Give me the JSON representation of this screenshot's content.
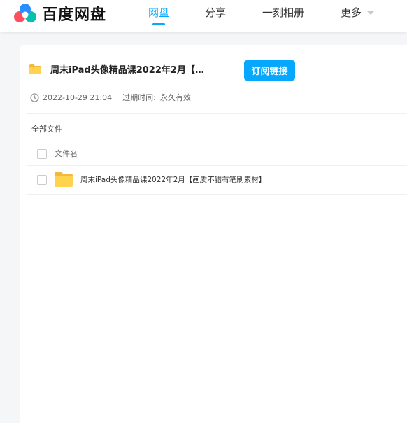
{
  "brand": {
    "name": "百度网盘"
  },
  "nav": {
    "items": [
      {
        "label": "网盘",
        "active": true
      },
      {
        "label": "分享",
        "active": false
      },
      {
        "label": "一刻相册",
        "active": false
      },
      {
        "label": "更多",
        "active": false,
        "has_dropdown": true
      }
    ]
  },
  "share": {
    "title": "周末iPad头像精品课2022年2月【...",
    "subscribe_label": "订阅链接",
    "date": "2022-10-29 21:04",
    "expire_label": "过期时间:",
    "expire_value": "永久有效"
  },
  "files": {
    "breadcrumb": "全部文件",
    "column_name": "文件名",
    "rows": [
      {
        "name": "周末iPad头像精品课2022年2月【画质不错有笔刷素材】",
        "icon": "folder-icon"
      }
    ]
  },
  "colors": {
    "accent": "#06a7ff",
    "folder": "#ffd34d",
    "page_bg": "#f5f6f8"
  }
}
